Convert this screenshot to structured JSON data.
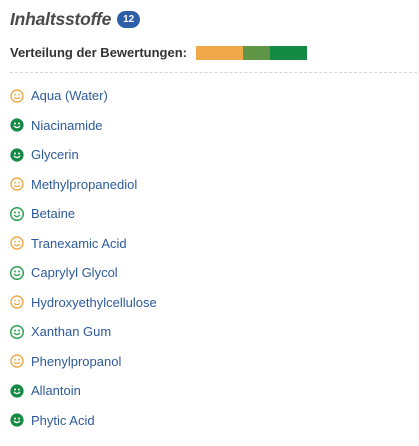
{
  "header": {
    "title": "Inhaltsstoffe",
    "count": "12"
  },
  "distribution": {
    "label": "Verteilung der Bewertungen:",
    "segments": [
      {
        "rating": "neutral",
        "fraction": 0.42,
        "color": "#f0a94a"
      },
      {
        "rating": "good",
        "fraction": 0.25,
        "color": "#5f9648"
      },
      {
        "rating": "very-good",
        "fraction": 0.33,
        "color": "#158a45"
      }
    ]
  },
  "colors": {
    "neutral": "#f0a94a",
    "good": "#2f9e52",
    "very_good": "#158a45",
    "link": "#2d5a9a",
    "badge": "#2c5fa8"
  },
  "ingredients": [
    {
      "name": "Aqua (Water)",
      "rating": "neutral"
    },
    {
      "name": "Niacinamide",
      "rating": "very-good"
    },
    {
      "name": "Glycerin",
      "rating": "very-good"
    },
    {
      "name": "Methylpropanediol",
      "rating": "neutral"
    },
    {
      "name": "Betaine",
      "rating": "good"
    },
    {
      "name": "Tranexamic Acid",
      "rating": "neutral"
    },
    {
      "name": "Caprylyl Glycol",
      "rating": "good"
    },
    {
      "name": "Hydroxyethylcellulose",
      "rating": "neutral"
    },
    {
      "name": "Xanthan Gum",
      "rating": "good"
    },
    {
      "name": "Phenylpropanol",
      "rating": "neutral"
    },
    {
      "name": "Allantoin",
      "rating": "very-good"
    },
    {
      "name": "Phytic Acid",
      "rating": "very-good"
    }
  ]
}
